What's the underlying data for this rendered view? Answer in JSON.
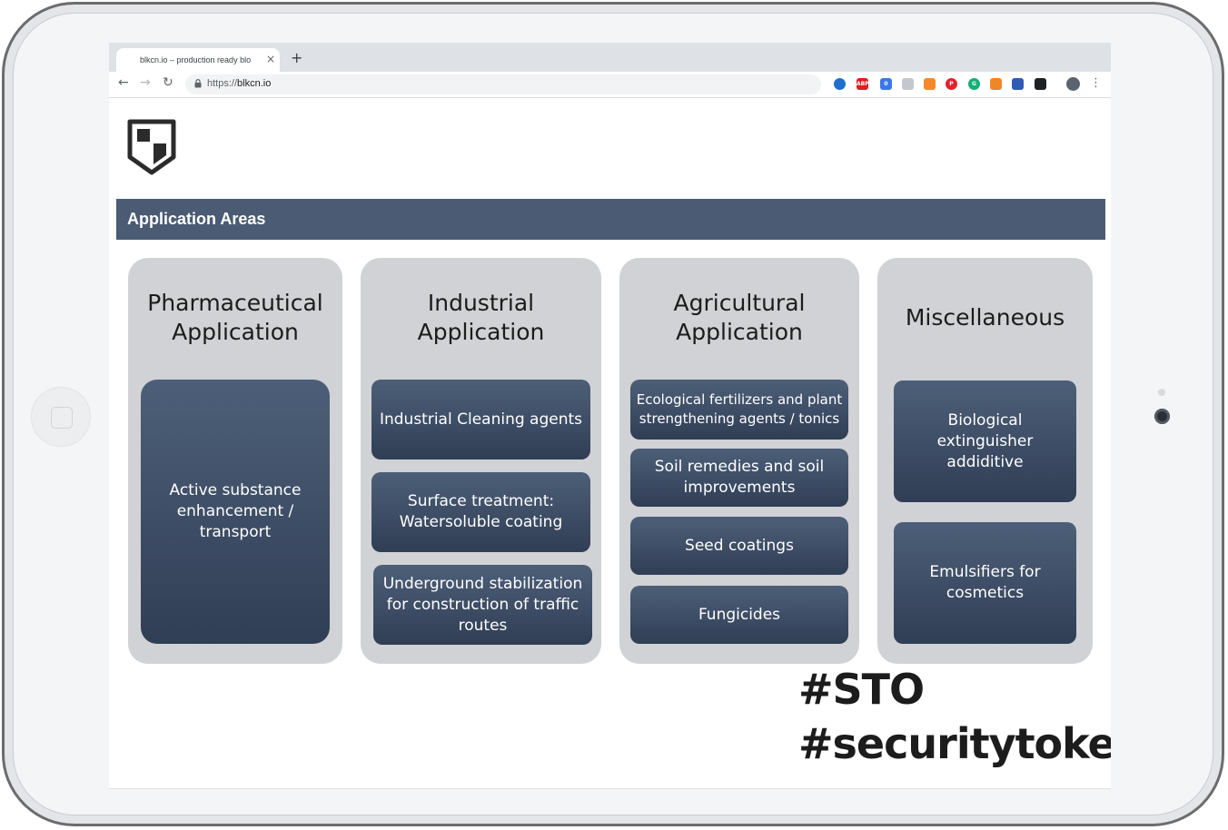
{
  "browser": {
    "tab_title": "blkcn.io – production ready blo",
    "tab_close": "×",
    "new_tab": "+",
    "back": "←",
    "forward": "→",
    "reload": "↻",
    "lock_icon": "🔒",
    "url_protocol": "https://",
    "url_host": "blkcn.io",
    "bookmark_star": "☆",
    "menu": "⋮",
    "extensions": [
      {
        "name": "ext-1",
        "color": "#1f6fd1",
        "label": ""
      },
      {
        "name": "adblock-plus",
        "color": "#d91f1f",
        "label": "ABP"
      },
      {
        "name": "ext-3",
        "color": "#3b78e7",
        "label": "0"
      },
      {
        "name": "ext-4",
        "color": "#c4c7cc",
        "label": ""
      },
      {
        "name": "ext-5",
        "color": "#f5892a",
        "label": ""
      },
      {
        "name": "pinterest",
        "color": "#e0232d",
        "label": "P"
      },
      {
        "name": "grammarly",
        "color": "#14b076",
        "label": "G"
      },
      {
        "name": "metamask",
        "color": "#f0862a",
        "label": ""
      },
      {
        "name": "ext-9",
        "color": "#2f5bb6",
        "label": ""
      },
      {
        "name": "ext-10",
        "color": "#202124",
        "label": ""
      }
    ]
  },
  "page": {
    "section_title": "Application Areas",
    "columns": [
      {
        "title_lines": [
          "Pharmaceutical",
          "Application"
        ],
        "items": [
          "Active substance enhancement / transport"
        ]
      },
      {
        "title_lines": [
          "Industrial",
          "Application"
        ],
        "items": [
          "Industrial Cleaning agents",
          "Surface treatment: Watersoluble coating",
          "Underground stabilization for construction of traffic routes"
        ]
      },
      {
        "title_lines": [
          "Agricultural",
          "Application"
        ],
        "items": [
          "Ecological fertilizers and plant strengthening agents / tonics",
          "Soil remedies and soil improvements",
          "Seed coatings",
          "Fungicides"
        ]
      },
      {
        "title_lines": [
          "Miscellaneous"
        ],
        "items": [
          "Biological extinguisher addiditive",
          "Emulsifiers for cosmetics"
        ]
      }
    ],
    "hashtags": [
      "#STO",
      "#securitytoken"
    ]
  },
  "colors": {
    "header_bar": "#4a5b73",
    "column_bg": "#d0d2d5",
    "box_top": "#4d5f78",
    "box_bottom": "#303e55"
  }
}
